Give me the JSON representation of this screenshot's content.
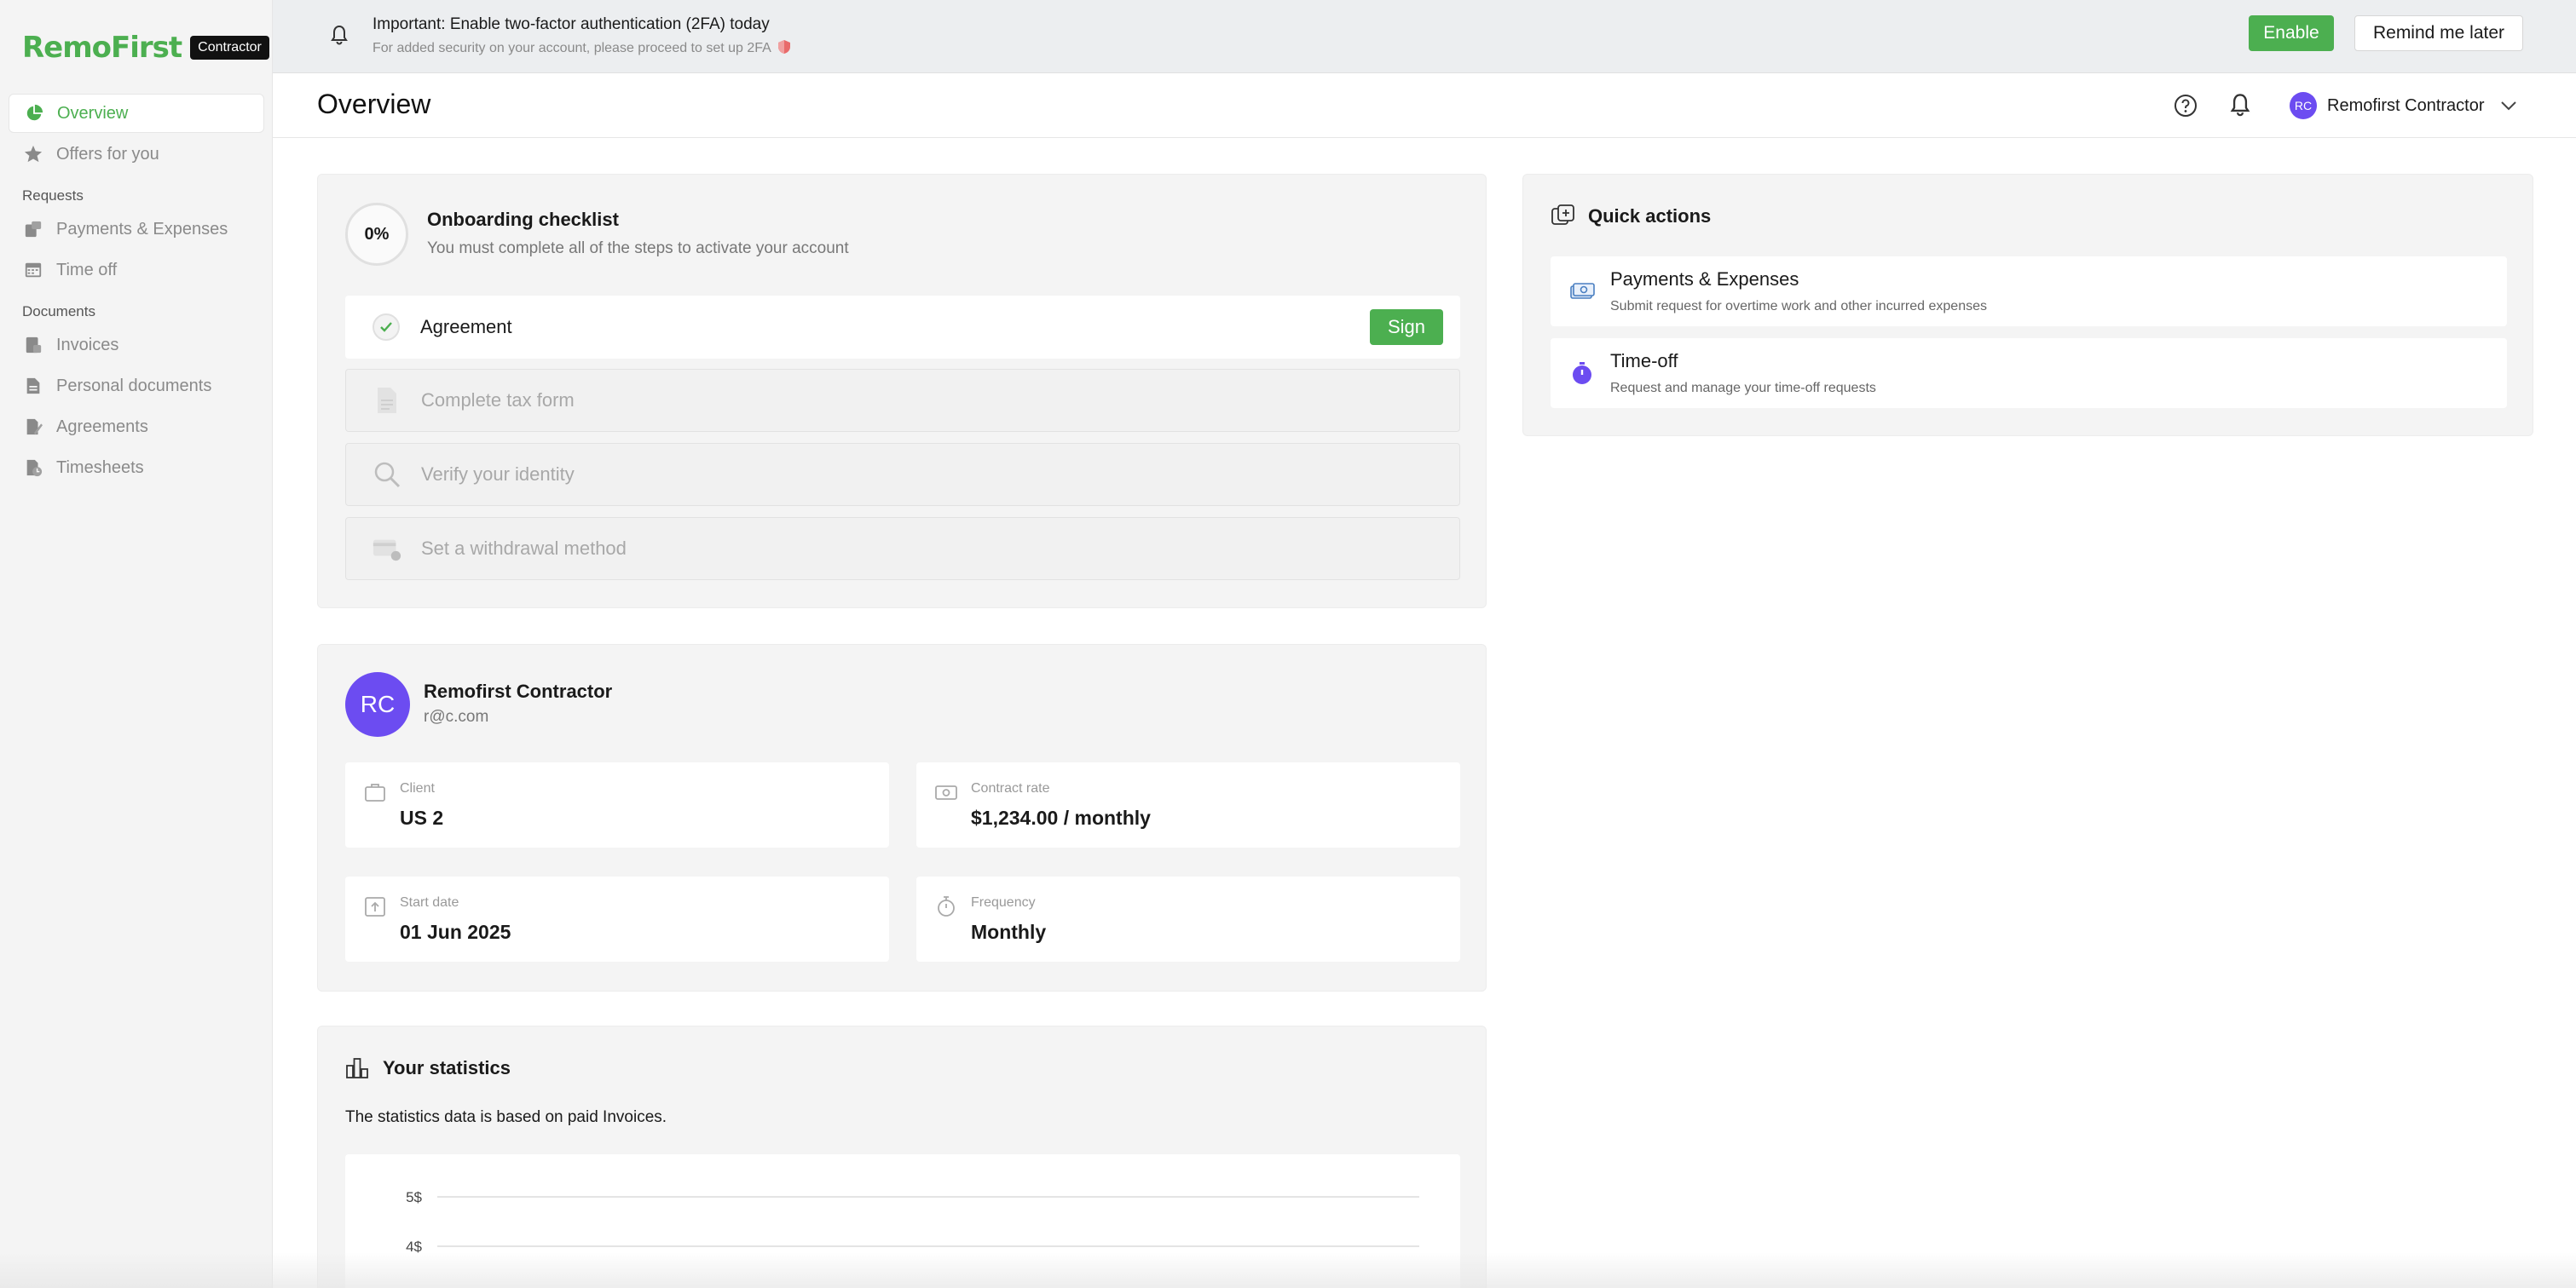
{
  "brand": {
    "logo": "RemoFirst",
    "badge": "Contractor",
    "accent": "#4caf50"
  },
  "sidebar": {
    "items": [
      {
        "label": "Overview",
        "icon": "pie-chart-icon"
      },
      {
        "label": "Offers for you",
        "icon": "star-badge-icon"
      }
    ],
    "requests_label": "Requests",
    "requests": [
      {
        "label": "Payments & Expenses",
        "icon": "cash-icon"
      },
      {
        "label": "Time off",
        "icon": "calendar-icon"
      }
    ],
    "documents_label": "Documents",
    "documents": [
      {
        "label": "Invoices",
        "icon": "invoice-icon"
      },
      {
        "label": "Personal documents",
        "icon": "document-icon"
      },
      {
        "label": "Agreements",
        "icon": "signature-icon"
      },
      {
        "label": "Timesheets",
        "icon": "timesheet-icon"
      }
    ]
  },
  "banner": {
    "title": "Important: Enable two-factor authentication (2FA) today",
    "subtitle": "For added security on your account, please proceed to set up 2FA",
    "enable_label": "Enable",
    "remind_label": "Remind me later"
  },
  "header": {
    "title": "Overview",
    "user_initials": "RC",
    "user_name": "Remofirst Contractor"
  },
  "onboarding": {
    "progress": "0%",
    "title": "Onboarding checklist",
    "subtitle": "You must complete all of the steps to activate your account",
    "steps": [
      {
        "label": "Agreement",
        "action": "Sign"
      },
      {
        "label": "Complete tax form"
      },
      {
        "label": "Verify your identity"
      },
      {
        "label": "Set a withdrawal method"
      }
    ]
  },
  "profile": {
    "initials": "RC",
    "name": "Remofirst Contractor",
    "email": "r@c.com",
    "client_label": "Client",
    "client_value": "US 2",
    "rate_label": "Contract rate",
    "rate_value": "$1,234.00 / monthly",
    "start_label": "Start date",
    "start_value": "01 Jun 2025",
    "freq_label": "Frequency",
    "freq_value": "Monthly"
  },
  "stats": {
    "title": "Your statistics",
    "subtitle": "The statistics data is based on paid Invoices."
  },
  "chart_data": {
    "type": "bar",
    "categories": [],
    "values": [],
    "title": "",
    "xlabel": "",
    "ylabel": "",
    "y_ticks": [
      "5$",
      "4$"
    ],
    "grid": true
  },
  "quick_actions": {
    "title": "Quick actions",
    "items": [
      {
        "title": "Payments & Expenses",
        "subtitle": "Submit request for overtime work and other incurred expenses",
        "icon": "cash-icon"
      },
      {
        "title": "Time-off",
        "subtitle": "Request and manage your time-off requests",
        "icon": "stopwatch-icon"
      }
    ]
  }
}
